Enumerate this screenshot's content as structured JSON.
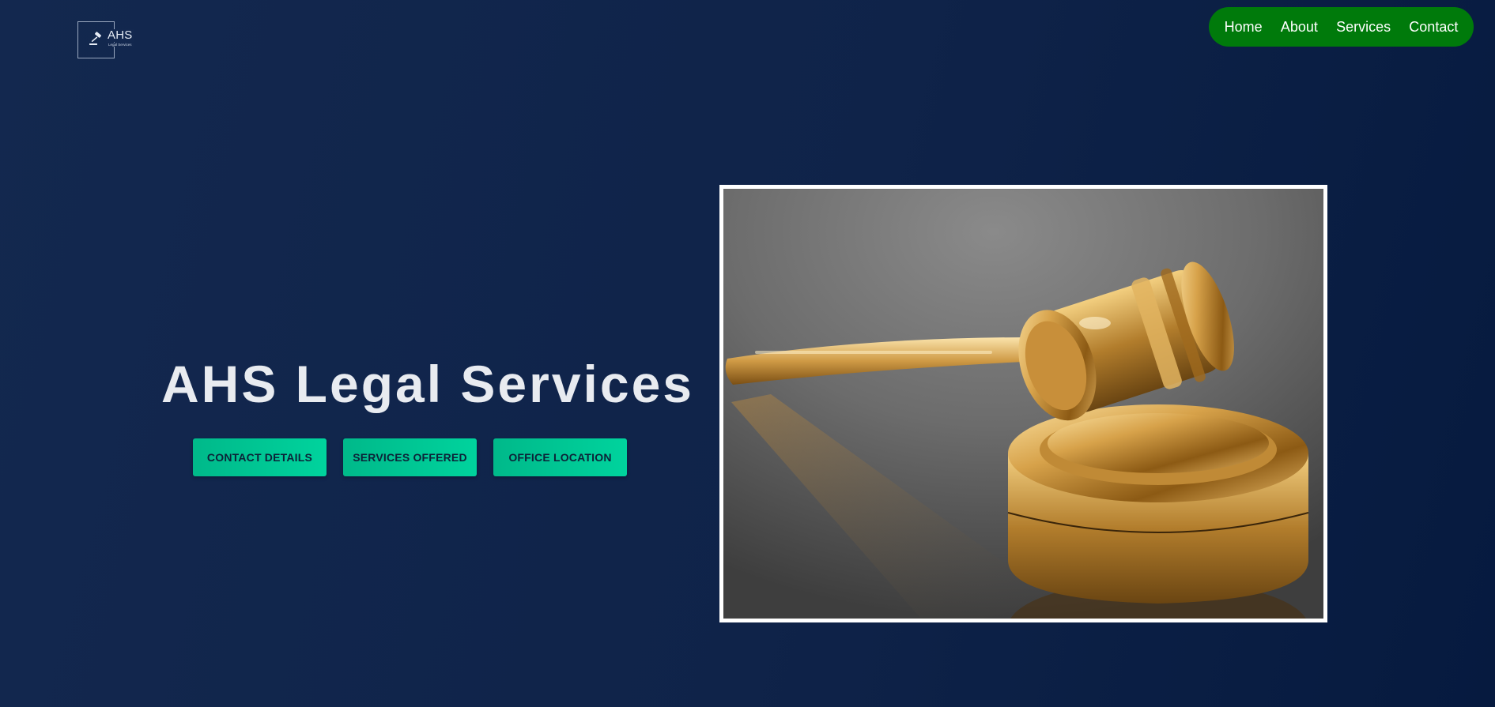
{
  "brand": {
    "logo_ahs": "AHS",
    "logo_sub": "Legal Services",
    "logo_icon": "gavel-icon"
  },
  "nav": {
    "items": [
      {
        "label": "Home"
      },
      {
        "label": "About"
      },
      {
        "label": "Services"
      },
      {
        "label": "Contact"
      }
    ],
    "background": "#007a0b"
  },
  "hero": {
    "title": "AHS Legal Services",
    "buttons": [
      {
        "label": "CONTACT DETAILS"
      },
      {
        "label": "SERVICES OFFERED"
      },
      {
        "label": "OFFICE LOCATION"
      }
    ],
    "button_color": "#00c896"
  },
  "image": {
    "subject": "gavel-image"
  },
  "colors": {
    "background": "#0f2349",
    "frame": "#ffffff",
    "gold": "#c99a3b"
  }
}
